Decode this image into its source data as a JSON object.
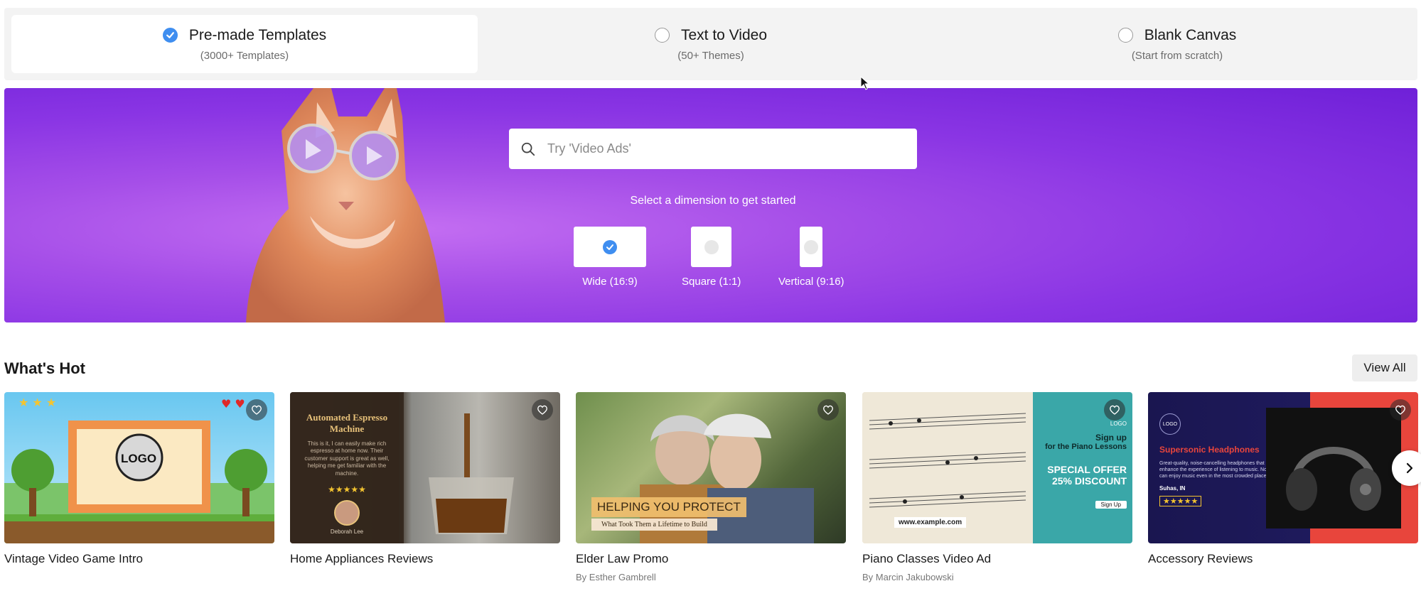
{
  "modes": [
    {
      "title": "Pre-made Templates",
      "subtitle": "(3000+ Templates)",
      "selected": true
    },
    {
      "title": "Text to Video",
      "subtitle": "(50+ Themes)",
      "selected": false
    },
    {
      "title": "Blank Canvas",
      "subtitle": "(Start from scratch)",
      "selected": false
    }
  ],
  "hero": {
    "search_placeholder": "Try 'Video Ads'",
    "prompt": "Select a dimension to get started",
    "dimensions": [
      {
        "label": "Wide (16:9)",
        "selected": true
      },
      {
        "label": "Square (1:1)",
        "selected": false
      },
      {
        "label": "Vertical (9:16)",
        "selected": false
      }
    ]
  },
  "section": {
    "title": "What's Hot",
    "view_all": "View All"
  },
  "cards": [
    {
      "title": "Vintage Video Game Intro",
      "author": "",
      "logo_text": "LOGO"
    },
    {
      "title": "Home Appliances Reviews",
      "author": "",
      "overlay_title": "Automated Espresso Machine",
      "overlay_text": "This is it, I can easily make rich espresso at home now. Their customer support is great as well, helping me get familiar with the machine.",
      "overlay_name": "Deborah Lee"
    },
    {
      "title": "Elder Law Promo",
      "author": "By Esther Gambrell",
      "banner": "HELPING YOU PROTECT",
      "banner_sub": "What Took Them a Lifetime to Build"
    },
    {
      "title": "Piano Classes Video Ad",
      "author": "By Marcin Jakubowski",
      "logo": "LOGO",
      "line1": "Sign up",
      "line2": "for the Piano Lessons",
      "offer1": "SPECIAL OFFER",
      "offer2": "25% DISCOUNT",
      "url": "www.example.com",
      "cta": "Sign Up"
    },
    {
      "title": "Accessory Reviews",
      "author": "",
      "logo": "LOGO",
      "headline": "Supersonic Headphones",
      "body": "Great-quality, noise-cancelling headphones that enhance the experience of listening to music. Now I can enjoy music even in the most crowded places.",
      "reviewer": "Suhas, IN"
    }
  ],
  "colors": {
    "accent": "#3f8ef0",
    "hero_purple": "#8a35e4"
  }
}
